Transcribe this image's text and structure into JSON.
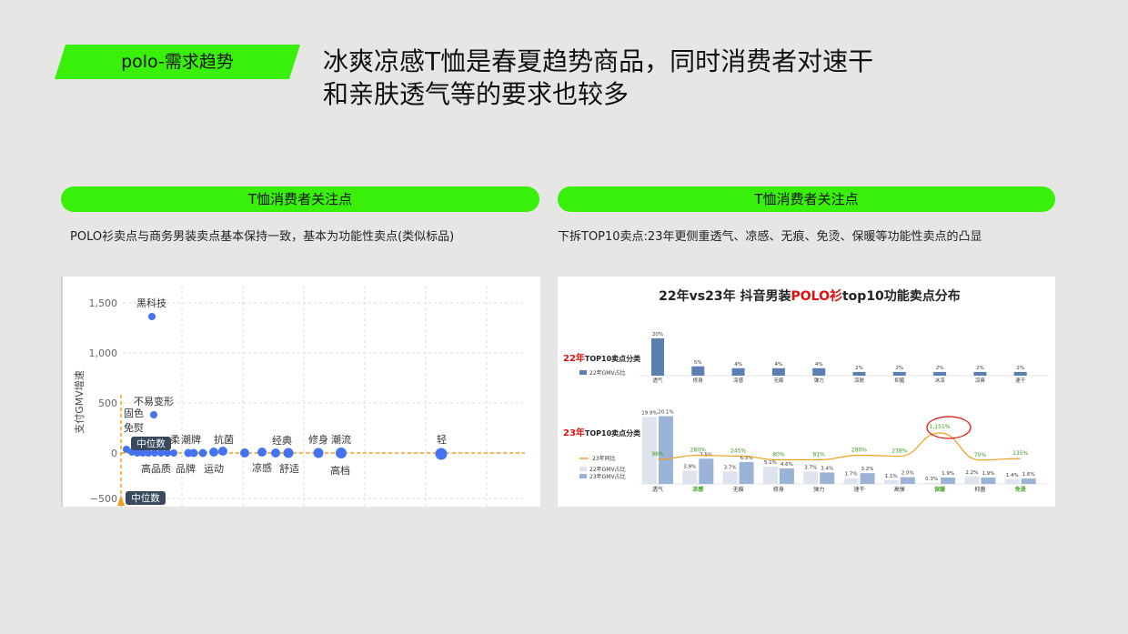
{
  "header": {
    "tag": "polo-需求趋势",
    "title_line1": "冰爽凉感T恤是春夏趋势商品，同时消费者对速干",
    "title_line2": "和亲肤透气等的要求也较多"
  },
  "left": {
    "pill": "T恤消费者关注点",
    "desc": "POLO衫卖点与商务男装卖点基本保持一致，基本为功能性卖点(类似标品)",
    "chart_data": {
      "type": "scatter",
      "ylabel": "支付GMV增速",
      "yticks": [
        "1,500",
        "1,000",
        "500",
        "0",
        "−500"
      ],
      "median_label": "中位数",
      "median_label_bottom": "中位数",
      "points_labels": [
        "黑科技",
        "不易变形",
        "固色",
        "免熨",
        "柔",
        "潮牌",
        "抗菌",
        "经典",
        "修身",
        "潮流",
        "轻",
        "高品质",
        "品牌",
        "运动",
        "凉感",
        "舒适",
        "高档"
      ],
      "colors": {
        "point": "#4472f0",
        "median": "#f0a020"
      }
    }
  },
  "right": {
    "pill": "T恤消费者关注点",
    "desc": "下拆TOP10卖点:23年更侧重透气、凉感、无痕、免烫、保暖等功能性卖点的凸显",
    "chart_data": {
      "type": "bar",
      "title_pre": "22年vs23年 抖音男装",
      "title_hl": "POLO衫",
      "title_post": "top10功能卖点分布",
      "top": {
        "label_year": "22年",
        "label_rest": "TOP10卖点分类",
        "legend": "22年GMV占比",
        "categories": [
          "透气",
          "修身",
          "凉感",
          "无痕",
          "弹力",
          "凉肤",
          "抑菌",
          "冰凉",
          "凉爽",
          "速干"
        ],
        "values": [
          20,
          5,
          4,
          4,
          4,
          2,
          2,
          2,
          2,
          2
        ],
        "value_labels": [
          "20%",
          "5%",
          "4%",
          "4%",
          "4%",
          "2%",
          "2%",
          "2%",
          "2%",
          "2%"
        ]
      },
      "bottom": {
        "label_year": "23年",
        "label_rest": "TOP10卖点分类",
        "legend_line": "23年同比",
        "legend_22": "22年GMV占比",
        "legend_23": "23年GMV占比",
        "categories": [
          "透气",
          "凉感",
          "无痕",
          "修身",
          "弹力",
          "速干",
          "高弹",
          "保暖",
          "抑菌",
          "免烫"
        ],
        "green_categories": [
          "凉感",
          "保暖",
          "免烫"
        ],
        "series": [
          {
            "name": "22年GMV占比",
            "values": [
              19.9,
              3.9,
              3.7,
              5.1,
              3.7,
              1.7,
              1.1,
              0.3,
              2.2,
              1.4
            ],
            "labels": [
              "19.9%",
              "3.9%",
              "3.7%",
              "5.1%",
              "3.7%",
              "1.7%",
              "1.1%",
              "0.3%",
              "2.2%",
              "1.4%"
            ]
          },
          {
            "name": "23年GMV占比",
            "values": [
              20.1,
              7.5,
              6.5,
              4.6,
              3.4,
              3.2,
              2.0,
              1.9,
              1.9,
              1.6
            ],
            "labels": [
              "20.1%",
              "7.5%",
              "6.5%",
              "4.6%",
              "3.4%",
              "3.2%",
              "2.0%",
              "1.9%",
              "1.9%",
              "1.6%"
            ]
          }
        ],
        "yoy": [
          98,
          280,
          245,
          80,
          81,
          280,
          238,
          1151,
          70,
          135
        ],
        "yoy_labels": [
          "98%",
          "280%",
          "245%",
          "80%",
          "81%",
          "280%",
          "238%",
          "1,151%",
          "70%",
          "135%"
        ]
      }
    }
  }
}
